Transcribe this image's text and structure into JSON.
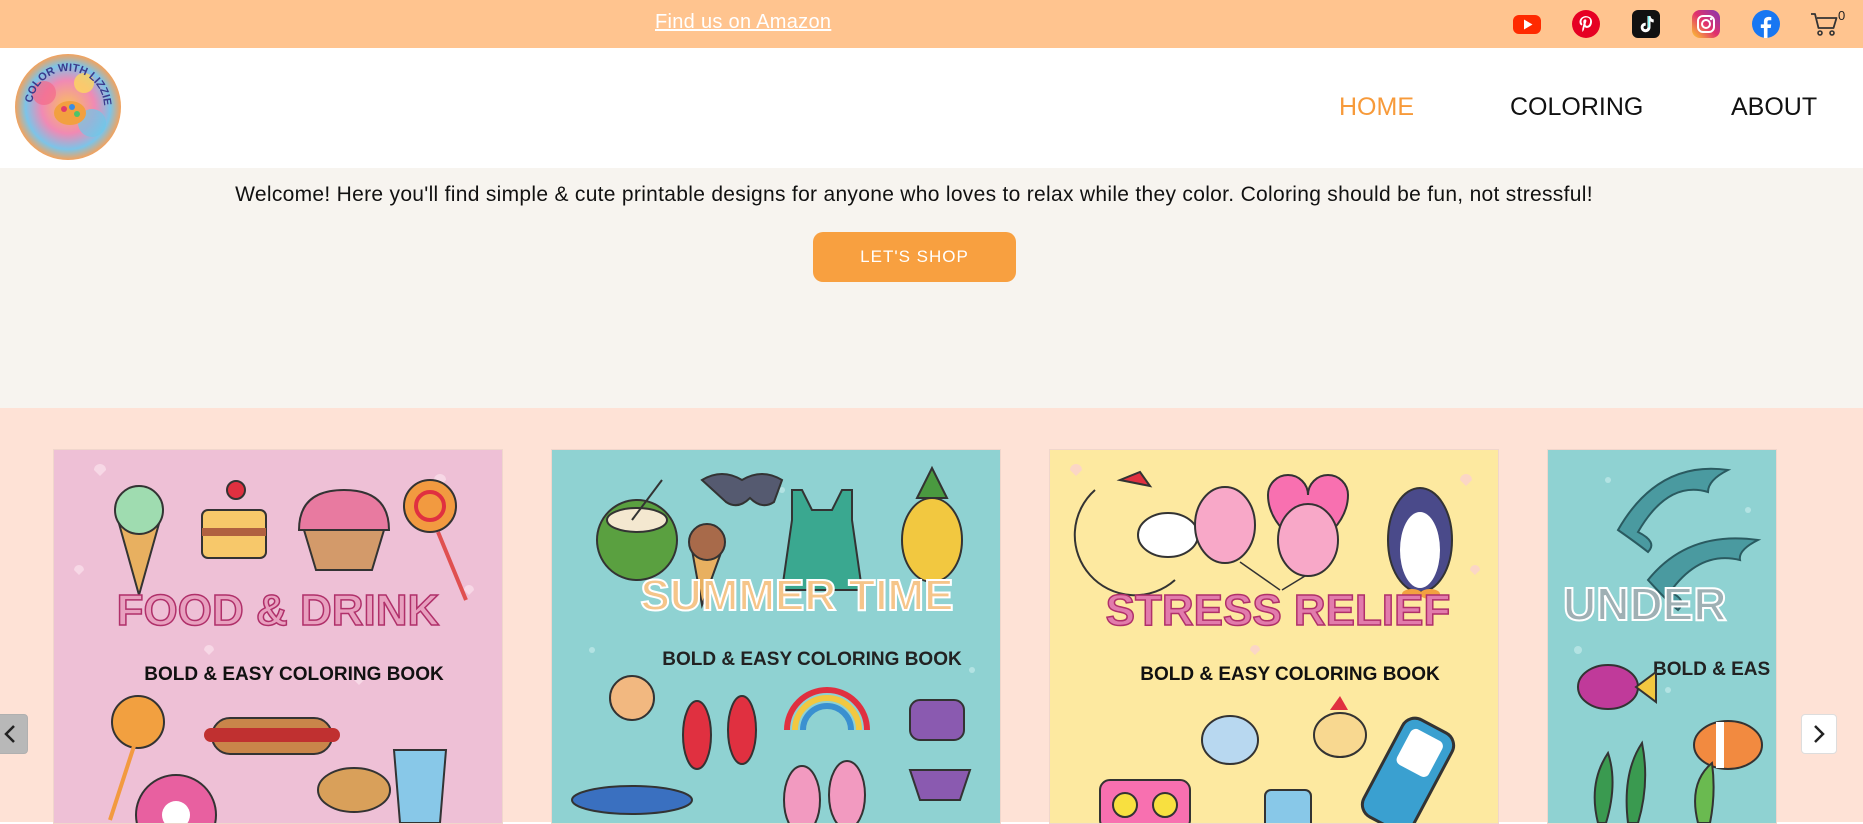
{
  "topbar": {
    "amazon_link": "Find us on Amazon",
    "socials": [
      "youtube-icon",
      "pinterest-icon",
      "tiktok-icon",
      "instagram-icon",
      "facebook-icon",
      "cart-icon"
    ],
    "cart_count": "0"
  },
  "header": {
    "logo_text": "COLOR WITH LIZZIE",
    "nav": [
      {
        "label": "HOME",
        "active": true
      },
      {
        "label": "COLORING",
        "active": false
      },
      {
        "label": "ABOUT",
        "active": false
      }
    ]
  },
  "hero": {
    "welcome": "Welcome! Here you'll find simple & cute printable designs for anyone who loves to relax while they color. Coloring should be fun, not stressful!",
    "button": "LET'S SHOP"
  },
  "books": [
    {
      "title": "FOOD & DRINK",
      "subtitle": "BOLD & EASY COLORING BOOK",
      "bg": "#eec0d6",
      "title_color": "#e8a0bf"
    },
    {
      "title": "SUMMER TIME",
      "subtitle": "BOLD & EASY COLORING BOOK",
      "bg": "#8fd2d2",
      "title_color": "#f5c58a"
    },
    {
      "title": "STRESS RELIEF",
      "subtitle": "BOLD & EASY COLORING BOOK",
      "bg": "#fde9a0",
      "title_color": "#e27bac"
    },
    {
      "title": "UNDER",
      "subtitle": "BOLD & EAS",
      "bg": "#8fd2d2",
      "title_color": "#9fb0b4"
    }
  ],
  "colors": {
    "topbar": "#ffc48f",
    "accent": "#f79a3a",
    "hero_bg": "#f7f4ef",
    "gallery_bg": "#fee2d6"
  }
}
